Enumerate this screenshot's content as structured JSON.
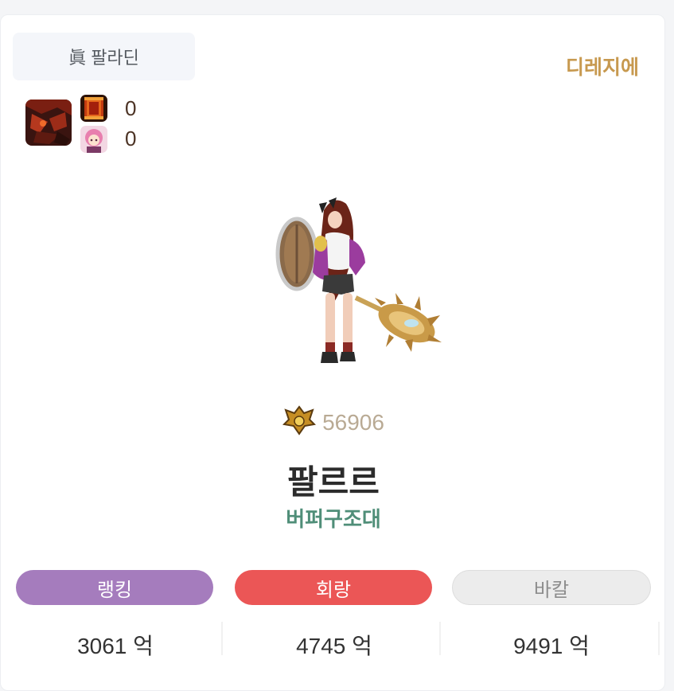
{
  "profile": {
    "class_name": "眞 팔라딘",
    "role": "디레지에",
    "items": [
      {
        "icon": "demon-mask-icon",
        "count": null
      },
      {
        "icon": "red-banner-icon",
        "count": "0"
      },
      {
        "icon": "pink-girl-icon",
        "count": "0"
      }
    ],
    "character_image": "paladin-character-sprite",
    "fame_icon": "golden-crest-icon",
    "fame": "56906",
    "name": "팔르르",
    "guild": "버퍼구조대",
    "colors": {
      "role": "#c7994f",
      "guild": "#4f8e78",
      "ranking_pill": "#a57cbd",
      "corridor_pill": "#eb5656",
      "bakal_pill": "#ececec"
    }
  },
  "stats": [
    {
      "label": "랭킹",
      "value": "3061 억"
    },
    {
      "label": "회랑",
      "value": "4745 억"
    },
    {
      "label": "바칼",
      "value": "9491 억"
    }
  ]
}
